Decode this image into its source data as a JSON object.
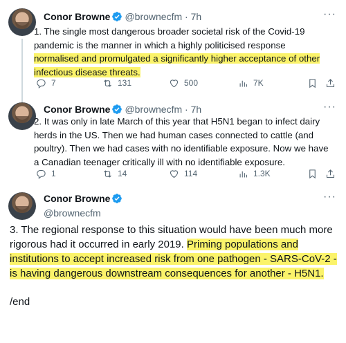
{
  "tweets": [
    {
      "name": "Conor Browne",
      "handle": "@brownecfm",
      "sep": "·",
      "time": "7h",
      "more": "···",
      "text_plain": "1. The single most dangerous broader societal risk of the Covid-19 pandemic is the manner in which a highly politicised response ",
      "text_hl": "normalised and promulgated a significantly higher acceptance of other infectious disease threats.",
      "replies": "7",
      "reposts": "131",
      "likes": "500",
      "views": "7K"
    },
    {
      "name": "Conor Browne",
      "handle": "@brownecfm",
      "sep": "·",
      "time": "7h",
      "more": "···",
      "text_plain": "2. It was only in late March of this year that H5N1 began to infect dairy herds in the US. Then we had human cases connected to cattle (and poultry). Then we had cases with no identifiable exposure. Now we have a Canadian teenager critically ill with no identifiable exposure.",
      "replies": "1",
      "reposts": "14",
      "likes": "114",
      "views": "1.3K"
    },
    {
      "name": "Conor Browne",
      "handle": "@brownecfm",
      "more": "···",
      "text_plain": "3. The regional response to this situation would have been much more rigorous had it occurred in early 2019. ",
      "text_hl": "Priming populations and institutions to accept increased risk from one pathogen - SARS-CoV-2 - is having dangerous downstream consequences for another - H5N1.",
      "end": "/end"
    }
  ],
  "colors": {
    "highlight": "#fbf36a",
    "verified": "#1d9bf0",
    "muted": "#536471",
    "thread_line": "#cfd9de"
  },
  "icons": [
    "verified-badge-icon",
    "reply-icon",
    "repost-icon",
    "like-icon",
    "views-icon",
    "bookmark-icon",
    "share-icon"
  ]
}
